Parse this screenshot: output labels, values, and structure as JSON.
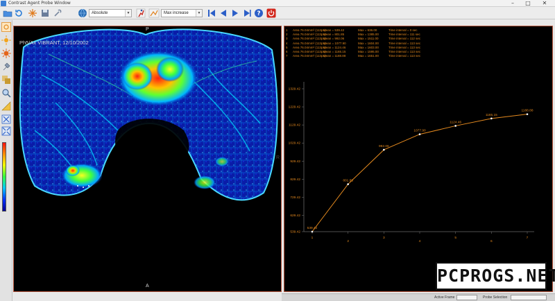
{
  "window": {
    "title": "Contrast Agent Probe Window",
    "controls": [
      "–",
      "□",
      "✕"
    ]
  },
  "toolbar": {
    "mode_select": "Absolute",
    "filter_select": "Max increase",
    "icons": [
      "open-folder-icon",
      "refresh-icon",
      "fireworks-icon",
      "save-icon",
      "wrench-icon",
      "globe-icon",
      "run-icon",
      "first-frame-icon",
      "previous-frame-icon",
      "play-icon",
      "next-frame-icon",
      "last-frame-icon",
      "help-icon",
      "power-icon"
    ]
  },
  "left_tools": {
    "icons": [
      "sun-target-icon",
      "brightness-icon",
      "contrast-icon",
      "probe-icon",
      "duplicate-icon",
      "magnifier-icon",
      "ruler-icon",
      "fit-window-icon",
      "fullscreen-icon"
    ]
  },
  "image_panel": {
    "top_marker": "P",
    "bottom_marker": "A",
    "right_marker": "R",
    "series_label": "Ph5/Ax VIBRANT, 12/10/2002"
  },
  "legend": [
    {
      "index": "1",
      "area": "Area 76.04mm² (113px)",
      "mean": "Mean = 539.42",
      "max": "Max = 636.00",
      "time": "Time interval = 0 sec"
    },
    {
      "index": "2",
      "area": "Area 76.04mm² (113px)",
      "mean": "Mean = 801.85",
      "max": "Max = 1385.00",
      "time": "Time interval = 111 sec"
    },
    {
      "index": "3",
      "area": "Area 76.04mm² (113px)",
      "mean": "Mean = 992.06",
      "max": "Max = 1511.00",
      "time": "Time interval = 112 sec"
    },
    {
      "index": "4",
      "area": "Area 76.04mm² (113px)",
      "mean": "Mean = 1077.90",
      "max": "Max = 1604.00",
      "time": "Time interval = 113 sec"
    },
    {
      "index": "5",
      "area": "Area 76.04mm² (113px)",
      "mean": "Mean = 1124.46",
      "max": "Max = 1603.00",
      "time": "Time interval = 113 sec"
    },
    {
      "index": "6",
      "area": "Area 76.04mm² (113px)",
      "mean": "Mean = 1165.15",
      "max": "Max = 1595.00",
      "time": "Time interval = 113 sec"
    },
    {
      "index": "7",
      "area": "Area 76.04mm² (113px)",
      "mean": "Mean = 1188.88",
      "max": "Max = 1651.00",
      "time": "Time interval = 113 sec"
    }
  ],
  "chart_data": {
    "type": "line",
    "title": "",
    "xlabel": "",
    "ylabel": "",
    "x": [
      1,
      2,
      3,
      4,
      5,
      6,
      7
    ],
    "x_tick_labels": [
      "1",
      "2",
      "3",
      "4",
      "5",
      "6",
      "7"
    ],
    "values": [
      539.42,
      801.85,
      992.06,
      1077.9,
      1124.46,
      1165.15,
      1188.88
    ],
    "value_labels": [
      "539.42",
      "801.85",
      "992.06",
      "1077.90",
      "1124.46",
      "1165.15",
      "1188.88"
    ],
    "y_tick_values": [
      539.42,
      629.42,
      729.42,
      829.42,
      929.42,
      1029.42,
      1129.42,
      1229.42,
      1329.42
    ],
    "y_tick_labels": [
      "539.42",
      "629.42",
      "729.42",
      "829.42",
      "929.42",
      "1029.42",
      "1129.42",
      "1229.42",
      "1329.42"
    ],
    "ylim": [
      539.42,
      1329.42
    ],
    "xlim": [
      1,
      7
    ],
    "grid": false,
    "line_color": "#e58a1f"
  },
  "statusbar": {
    "active_frame_label": "Active Frame",
    "probe_selection_label": "Probe Selection"
  },
  "watermark": "PCPROGS.NET",
  "colors": {
    "panel_border": "#b8573f",
    "chart_text": "#e58a1f",
    "background": "#000000"
  }
}
